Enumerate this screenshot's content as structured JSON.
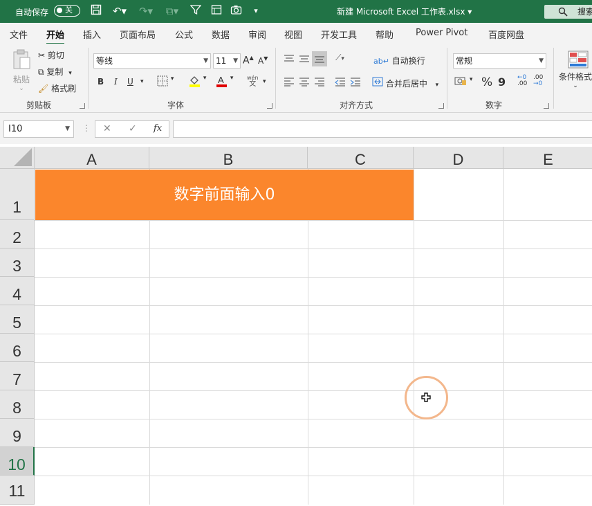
{
  "titlebar": {
    "autosave_label": "自动保存",
    "autosave_state": "关",
    "doc_title": "新建 Microsoft Excel 工作表.xlsx ▾",
    "search_label": "搜索"
  },
  "tabs": [
    "文件",
    "开始",
    "插入",
    "页面布局",
    "公式",
    "数据",
    "审阅",
    "视图",
    "开发工具",
    "帮助",
    "Power Pivot",
    "百度网盘"
  ],
  "active_tab": "开始",
  "ribbon": {
    "clipboard": {
      "paste": "粘贴",
      "cut": "剪切",
      "copy": "复制",
      "format_painter": "格式刷",
      "label": "剪贴板"
    },
    "font": {
      "font_name": "等线",
      "font_size": "11",
      "grow": "A",
      "shrink": "A",
      "bold": "B",
      "italic": "I",
      "underline": "U",
      "phonetic_top": "wén",
      "phonetic_bottom": "文",
      "label": "字体"
    },
    "alignment": {
      "wrap_text": "自动换行",
      "merge_center": "合并后居中",
      "label": "对齐方式"
    },
    "number": {
      "format": "常规",
      "percent": "%",
      "comma": "9",
      "inc_decimal": ".00",
      "dec_decimal": ".00",
      "label": "数字"
    },
    "styles": {
      "conditional_format": "条件格式"
    }
  },
  "formula_bar": {
    "name_box": "I10",
    "cancel": "✕",
    "enter": "✓",
    "fx": "fx",
    "formula": ""
  },
  "sheet": {
    "columns": [
      "A",
      "B",
      "C",
      "D",
      "E"
    ],
    "rows": [
      "1",
      "2",
      "3",
      "4",
      "5",
      "6",
      "7",
      "8",
      "9",
      "10",
      "11"
    ],
    "selected_row": "10",
    "merged_cell_text": "数字前面输入0",
    "merged_fill": "#fb862c"
  },
  "colors": {
    "brand": "#217346",
    "header_bg": "#e6e6e6"
  }
}
